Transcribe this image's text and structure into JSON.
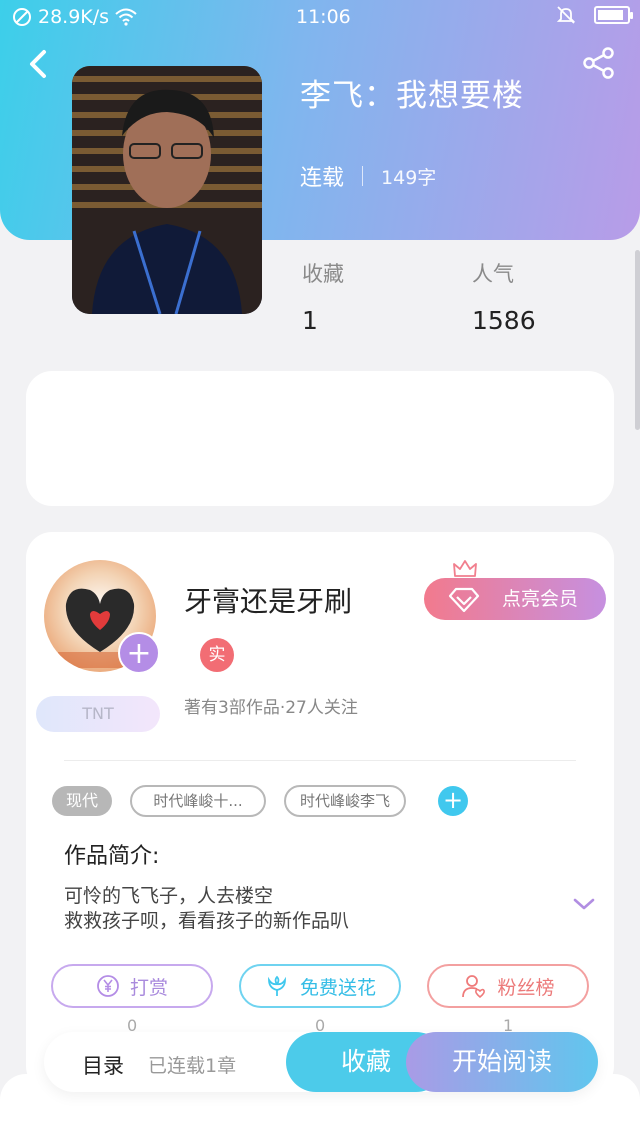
{
  "status_bar": {
    "network_speed": "28.9K/s",
    "time": "11:06",
    "battery_level": 0.9
  },
  "book": {
    "title": "李飞：我想要楼",
    "status": "连载",
    "word_count": "149字",
    "cover_icon": "book-cover-portrait"
  },
  "stats": {
    "favorites_label": "收藏",
    "favorites_value": "1",
    "popularity_label": "人气",
    "popularity_value": "1586"
  },
  "author": {
    "name": "牙膏还是牙刷",
    "verified_badge": "实",
    "summary": "著有3部作品·27人关注",
    "badge_text": "TNT",
    "vip_button": "点亮会员"
  },
  "tags": {
    "genre": "现代",
    "items": [
      "时代峰峻十...",
      "时代峰峻李飞"
    ]
  },
  "intro": {
    "title": "作品简介:",
    "lines": [
      "可怜的飞飞子，人去楼空",
      "救救孩子呗，看看孩子的新作品叭"
    ]
  },
  "actions": [
    {
      "label": "打赏",
      "count": "0",
      "color": "#b48de6",
      "icon": "yen-icon"
    },
    {
      "label": "免费送花",
      "count": "0",
      "color": "#40c8ee",
      "icon": "flower-icon"
    },
    {
      "label": "粉丝榜",
      "count": "1",
      "color": "#ef7b7b",
      "icon": "fan-user-icon"
    }
  ],
  "bottom_bar": {
    "catalog": "目录",
    "chapters": "已连载1章",
    "collect": "收藏",
    "read": "开始阅读"
  }
}
